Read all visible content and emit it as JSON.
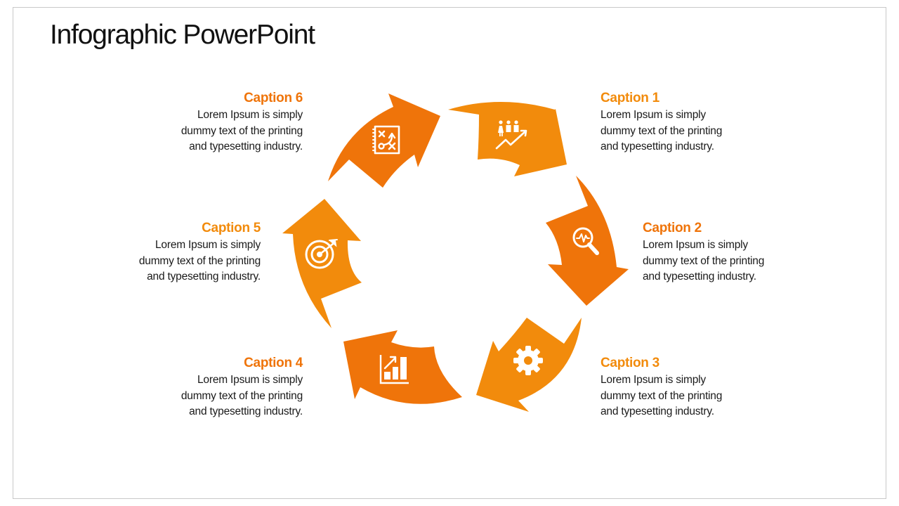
{
  "slide": {
    "title": "Infographic PowerPoint"
  },
  "colors": {
    "light_orange": "#F28B0C",
    "dark_orange": "#EF740A",
    "icon_white": "#FFFFFF",
    "body_text": "#1A1A1A"
  },
  "steps": [
    {
      "id": 1,
      "caption": "Caption 1",
      "lines": [
        "Lorem Ipsum is simply",
        "dummy text of the printing",
        "and typesetting industry."
      ],
      "icon": "team-growth-icon",
      "tone": "light"
    },
    {
      "id": 2,
      "caption": "Caption 2",
      "lines": [
        "Lorem Ipsum is simply",
        "dummy text of the printing",
        "and typesetting industry."
      ],
      "icon": "magnifier-pulse-icon",
      "tone": "dark"
    },
    {
      "id": 3,
      "caption": "Caption 3",
      "lines": [
        "Lorem Ipsum is simply",
        "dummy text of the printing",
        "and typesetting industry."
      ],
      "icon": "gear-icon",
      "tone": "light"
    },
    {
      "id": 4,
      "caption": "Caption 4",
      "lines": [
        "Lorem Ipsum is simply",
        "dummy text of the printing",
        "and typesetting industry."
      ],
      "icon": "bar-chart-growth-icon",
      "tone": "dark"
    },
    {
      "id": 5,
      "caption": "Caption 5",
      "lines": [
        "Lorem Ipsum is simply",
        "dummy text of the printing",
        "and typesetting industry."
      ],
      "icon": "target-arrow-icon",
      "tone": "light"
    },
    {
      "id": 6,
      "caption": "Caption 6",
      "lines": [
        "Lorem Ipsum is simply",
        "dummy text of the printing",
        "and typesetting industry."
      ],
      "icon": "strategy-board-icon",
      "tone": "dark"
    }
  ]
}
